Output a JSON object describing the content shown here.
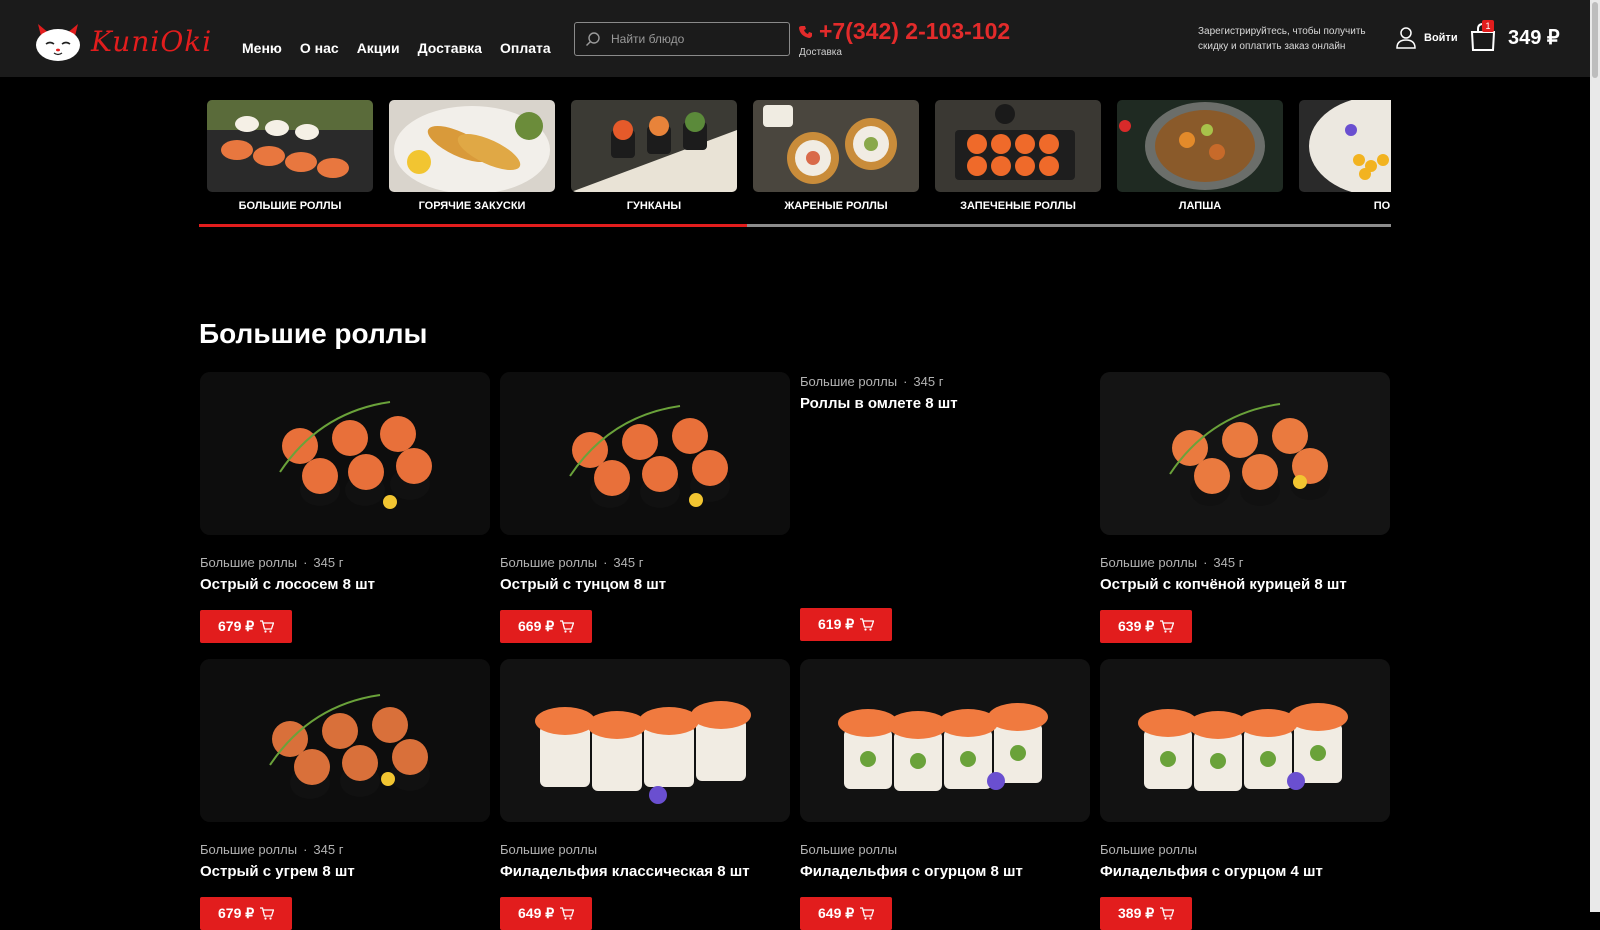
{
  "brand": {
    "name": "KuniOki"
  },
  "nav": [
    "Меню",
    "О нас",
    "Акции",
    "Доставка",
    "Оплата"
  ],
  "search": {
    "placeholder": "Найти блюдо"
  },
  "phone": {
    "number": "+7(342) 2-103-102",
    "caption": "Доставка"
  },
  "promo_text": "Зарегистрируйтесь, чтобы получить скидку и оплатить заказ онлайн",
  "login_label": "Войти",
  "cart": {
    "count": "1",
    "total": "349 ₽"
  },
  "categories": [
    "БОЛЬШИЕ РОЛЛЫ",
    "ГОРЯЧИЕ ЗАКУСКИ",
    "ГУНКАНЫ",
    "ЖАРЕНЫЕ РОЛЛЫ",
    "ЗАПЕЧЕНЫЕ РОЛЛЫ",
    "ЛАПША",
    "ПО"
  ],
  "category_scroll_progress": 0.46,
  "section_title": "Большие роллы",
  "products": [
    {
      "category": "Большие роллы",
      "weight": "345 г",
      "name": "Острый с лососем 8 шт",
      "price": "679 ₽"
    },
    {
      "category": "Большие роллы",
      "weight": "345 г",
      "name": "Острый с тунцом 8 шт",
      "price": "669 ₽"
    },
    {
      "category": "Большие роллы",
      "weight": "345 г",
      "name": "Роллы в омлете 8 шт",
      "price": "619 ₽"
    },
    {
      "category": "Большие роллы",
      "weight": "345 г",
      "name": "Острый с копчёной курицей 8 шт",
      "price": "639 ₽"
    },
    {
      "category": "Большие роллы",
      "weight": "345 г",
      "name": "Острый с угрем 8 шт",
      "price": "679 ₽"
    },
    {
      "category": "Большие роллы",
      "weight": "",
      "name": "Филадельфия классическая 8 шт",
      "price": "649 ₽"
    },
    {
      "category": "Большие роллы",
      "weight": "",
      "name": "Филадельфия с огурцом 8 шт",
      "price": "649 ₽"
    },
    {
      "category": "Большие роллы",
      "weight": "",
      "name": "Филадельфия с огурцом 4 шт",
      "price": "389 ₽"
    }
  ],
  "colors": {
    "accent": "#e21d1d",
    "header_bg": "#1b1b1b",
    "page_bg": "#000000"
  },
  "icons": [
    "cat-logo-icon",
    "search-icon",
    "phone-icon",
    "user-icon",
    "shopping-bag-icon",
    "cart-icon"
  ]
}
